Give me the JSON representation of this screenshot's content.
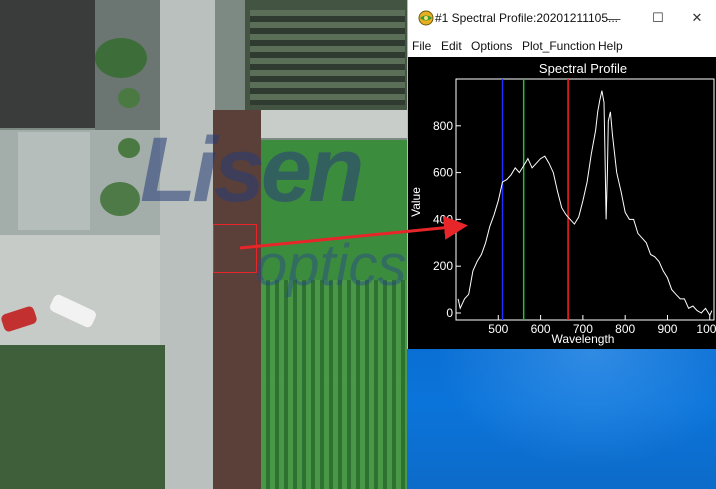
{
  "watermark": {
    "logo_main": "Lisen",
    "logo_sub": "optics"
  },
  "window": {
    "title": "#1 Spectral Profile:20201211105...",
    "controls": {
      "minimize": "—",
      "maximize": "☐",
      "close": "✕"
    },
    "menu": [
      "File",
      "Edit",
      "Options",
      "Plot_Function",
      "Help"
    ]
  },
  "chart_data": {
    "type": "line",
    "title": "Spectral Profile",
    "xlabel": "Wavelength",
    "ylabel": "Value",
    "xlim": [
      400,
      1010
    ],
    "ylim": [
      -30,
      1000
    ],
    "xticks": [
      500,
      600,
      700,
      800,
      900,
      1000
    ],
    "yticks": [
      0,
      200,
      400,
      600,
      800
    ],
    "markers": [
      {
        "x": 510,
        "color": "#2030ff"
      },
      {
        "x": 560,
        "color": "#20c040"
      },
      {
        "x": 665,
        "color": "#ff2020"
      }
    ],
    "series": [
      {
        "color": "#ffffff",
        "x": [
          405,
          410,
          420,
          430,
          440,
          450,
          460,
          470,
          480,
          490,
          500,
          510,
          520,
          530,
          540,
          550,
          560,
          570,
          580,
          590,
          600,
          610,
          620,
          630,
          640,
          650,
          660,
          670,
          680,
          690,
          700,
          710,
          720,
          730,
          735,
          740,
          745,
          750,
          752,
          755,
          758,
          760,
          765,
          770,
          780,
          790,
          800,
          810,
          820,
          830,
          840,
          850,
          860,
          870,
          880,
          890,
          900,
          910,
          920,
          930,
          940,
          950,
          960,
          970,
          980,
          990,
          1000,
          1005
        ],
        "y": [
          60,
          20,
          60,
          80,
          180,
          220,
          250,
          300,
          370,
          420,
          480,
          560,
          570,
          590,
          620,
          600,
          630,
          660,
          620,
          640,
          660,
          670,
          640,
          600,
          520,
          450,
          420,
          400,
          380,
          410,
          480,
          560,
          680,
          780,
          860,
          910,
          950,
          900,
          700,
          400,
          600,
          820,
          860,
          760,
          600,
          520,
          430,
          400,
          400,
          340,
          320,
          300,
          250,
          240,
          220,
          180,
          150,
          100,
          80,
          60,
          60,
          20,
          30,
          10,
          0,
          20,
          -10,
          10
        ]
      }
    ]
  }
}
